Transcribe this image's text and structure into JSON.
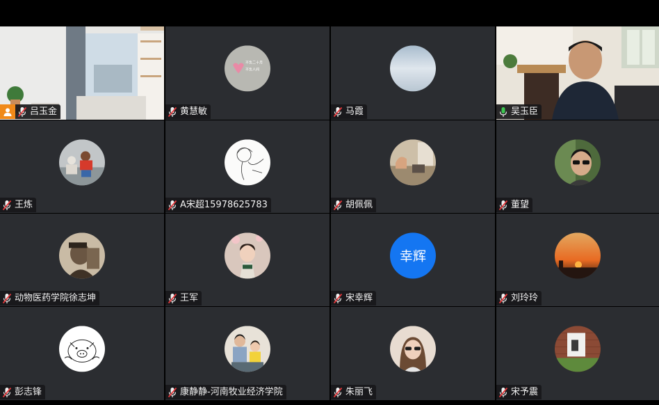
{
  "participants": [
    {
      "name": "吕玉金",
      "avatar": "video-room",
      "muted": true,
      "host": true
    },
    {
      "name": "黄慧敏",
      "avatar": "greeting-card",
      "muted": true
    },
    {
      "name": "马霞",
      "avatar": "sky-blue",
      "muted": true
    },
    {
      "name": "吴玉臣",
      "avatar": "video-man",
      "muted": false,
      "speaking": true
    },
    {
      "name": "王炼",
      "avatar": "children-play",
      "muted": true
    },
    {
      "name": "A宋超15978625783",
      "avatar": "sketch-girl",
      "muted": true
    },
    {
      "name": "胡佩佩",
      "avatar": "bedroom",
      "muted": true
    },
    {
      "name": "董望",
      "avatar": "sunglasses-man",
      "muted": true
    },
    {
      "name": "动物医药学院徐志坤",
      "avatar": "sepia-man",
      "muted": true
    },
    {
      "name": "王军",
      "avatar": "little-girl",
      "muted": true
    },
    {
      "name": "宋幸辉",
      "avatar": "text",
      "avatar_text": "幸辉",
      "muted": true
    },
    {
      "name": "刘玲玲",
      "avatar": "sunset",
      "muted": true
    },
    {
      "name": "彭志锋",
      "avatar": "cartoon-pig",
      "muted": true
    },
    {
      "name": "康静静-河南牧业经济学院",
      "avatar": "two-kids",
      "muted": true
    },
    {
      "name": "朱丽飞",
      "avatar": "woman-sunglasses",
      "muted": true
    },
    {
      "name": "宋予震",
      "avatar": "brick-window",
      "muted": true
    }
  ],
  "colors": {
    "tile_bg": "#2b2d31",
    "active_border": "#30c64a",
    "host_badge": "#f08a1a",
    "muted_mic": "#e5383b",
    "active_mic": "#3cc750",
    "text_avatar": "#1476f2"
  }
}
